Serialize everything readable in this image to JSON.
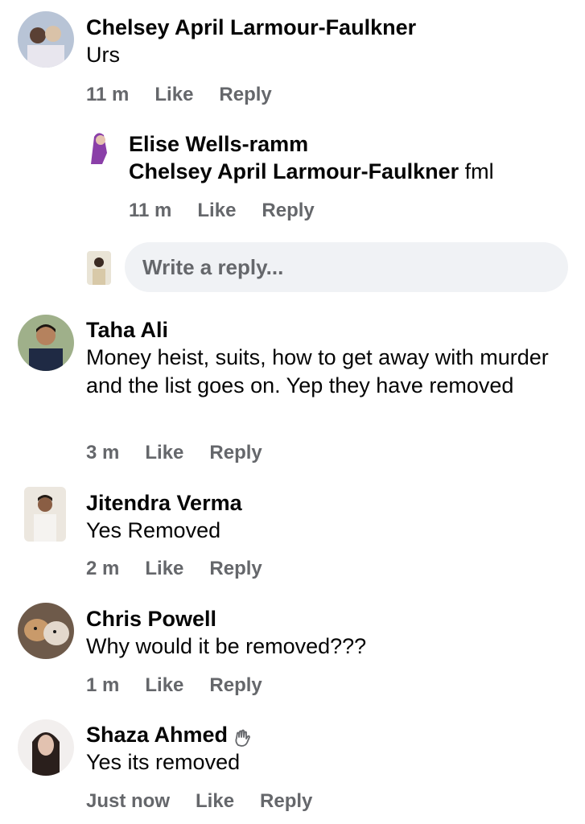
{
  "comments": [
    {
      "author": "Chelsey April Larmour-Faulkner",
      "text": "Urs",
      "time": "11 m",
      "like": "Like",
      "reply": "Reply"
    },
    {
      "author": "Elise Wells-ramm",
      "mention": "Chelsey April Larmour-Faulkner",
      "text": " fml",
      "time": "11 m",
      "like": "Like",
      "reply": "Reply"
    },
    {
      "author": "Taha Ali",
      "text": "Money heist, suits, how to get away with murder and the list goes on. Yep they have removed",
      "time": "3 m",
      "like": "Like",
      "reply": "Reply"
    },
    {
      "author": "Jitendra Verma",
      "text": "Yes Removed",
      "time": "2 m",
      "like": "Like",
      "reply": "Reply"
    },
    {
      "author": "Chris Powell",
      "text": "Why would it be removed???",
      "time": "1 m",
      "like": "Like",
      "reply": "Reply"
    },
    {
      "author": "Shaza Ahmed",
      "badge": "wave-hand-icon",
      "text": "Yes its removed",
      "time": "Just now",
      "like": "Like",
      "reply": "Reply"
    }
  ],
  "reply_input": {
    "placeholder": "Write a reply..."
  },
  "colors": {
    "text": "#050505",
    "secondary": "#65676b",
    "input_bg": "#f0f2f5"
  }
}
